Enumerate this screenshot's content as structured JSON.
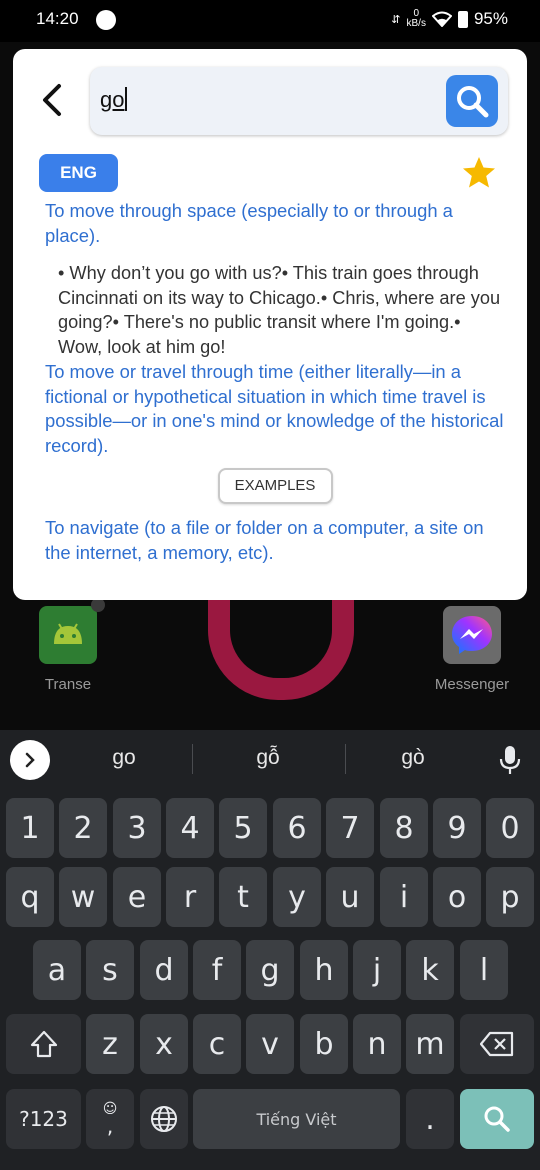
{
  "status_bar": {
    "time": "14:20",
    "net_speed_top": "0",
    "net_speed_unit": "kB/s",
    "battery": "95%"
  },
  "home_apps": [
    {
      "label": "Transe",
      "icon": "android-icon"
    },
    {
      "label": "Messenger",
      "icon": "messenger-icon"
    }
  ],
  "dictionary": {
    "search_value": "go",
    "language_badge": "ENG",
    "favorite_color": "#f6b900",
    "accent_color": "#3a86e8",
    "def1": "To move through space (especially to or through a place).",
    "examples1": "• Why don’t you go with us?• This train goes through Cincinnati on its way to Chicago.• Chris, where are you going?• There's no public transit where I'm going.• Wow, look at him go!",
    "def2": "To move or travel through time (either literally—in a fictional or hypothetical situation in which time travel is possible—or in one's mind or knowledge of the historical record).",
    "examples_button": "EXAMPLES",
    "def3": "To navigate (to a file or folder on a computer, a site on the internet, a memory, etc)."
  },
  "keyboard": {
    "suggestions": [
      "go",
      "gỗ",
      "gò"
    ],
    "row_numbers": [
      "1",
      "2",
      "3",
      "4",
      "5",
      "6",
      "7",
      "8",
      "9",
      "0"
    ],
    "row1": [
      "q",
      "w",
      "e",
      "r",
      "t",
      "y",
      "u",
      "i",
      "o",
      "p"
    ],
    "row2": [
      "a",
      "s",
      "d",
      "f",
      "g",
      "h",
      "j",
      "k",
      "l"
    ],
    "row3": [
      "z",
      "x",
      "c",
      "v",
      "b",
      "n",
      "m"
    ],
    "symbols_key": "?123",
    "emoji_comma": ",",
    "space_label": "Tiếng Việt",
    "period": "."
  }
}
